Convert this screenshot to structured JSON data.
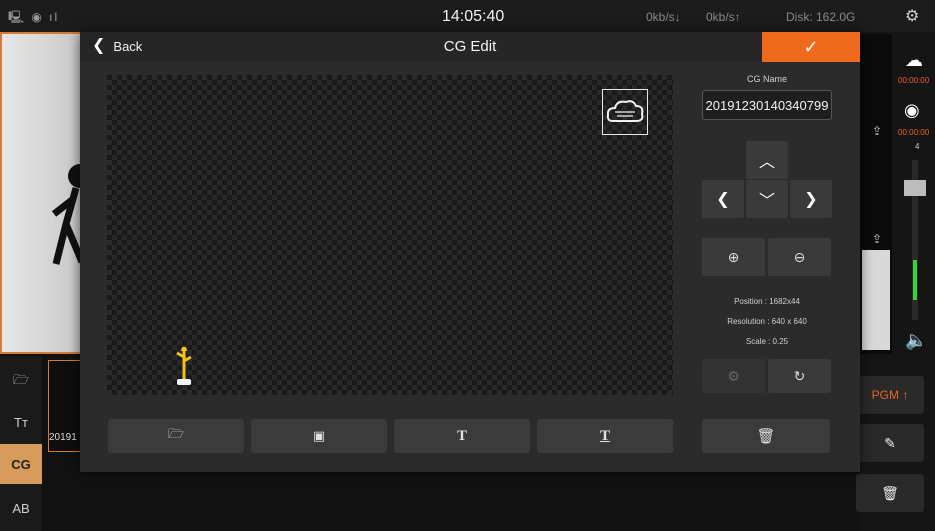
{
  "status_bar": {
    "icons": "🖳 ◉ ıl",
    "time": "14:05:40",
    "download": "0kb/s↓",
    "upload": "0kb/s↑",
    "disk": "Disk: 162.0G",
    "settings_icon": "gear-icon"
  },
  "background": {
    "side_tabs": [
      "folder-icon",
      "Tт",
      "CG",
      "AB"
    ],
    "thumb_label": "20191",
    "right": {
      "time1": "00:00:00",
      "time2": "00:00:00",
      "level": "4",
      "pgm_label": "PGM ↑"
    }
  },
  "dialog": {
    "back_label": "Back",
    "title": "CG Edit",
    "confirm_icon": "check-icon",
    "cg_name_label": "CG Name",
    "cg_name_value": "20191230140340799",
    "position": "Position : 1682x44",
    "resolution": "Resolution : 640 x 640",
    "scale": "Scale : 0.25",
    "accent": "#ef6a1c",
    "toolbar": [
      {
        "name": "folder-icon"
      },
      {
        "name": "image-icon"
      },
      {
        "name": "text-icon",
        "label": "T"
      },
      {
        "name": "subtitle-text-icon",
        "label": "T"
      }
    ]
  }
}
